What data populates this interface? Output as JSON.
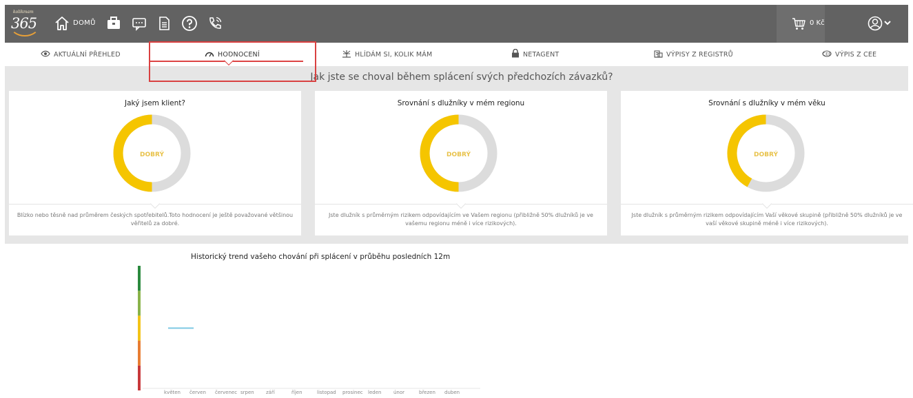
{
  "topbar": {
    "logo_brand": "kolikmam",
    "logo_number": "365",
    "home_label": "DOMŮ",
    "icons": [
      "home-icon",
      "briefcase-icon",
      "chat-icon",
      "document-icon",
      "help-icon",
      "phone-icon"
    ],
    "cart_label": "0 Kč",
    "user_icon": "user-icon",
    "colors": {
      "bar": "#626262",
      "cart_bg": "#6e6e6e"
    }
  },
  "tabs": [
    {
      "label": "AKTUÁLNÍ PŘEHLED",
      "icon": "eye-icon"
    },
    {
      "label": "HODNOCENÍ",
      "icon": "gauge-icon",
      "active": true
    },
    {
      "label": "HLÍDÁM SI, KOLIK MÁM",
      "icon": "radar-icon"
    },
    {
      "label": "NETAGENT",
      "icon": "lock-icon"
    },
    {
      "label": "VÝPISY Z REGISTRŮ",
      "icon": "building-icon"
    },
    {
      "label": "VÝPIS Z CEE",
      "icon": "cee-icon"
    }
  ],
  "main": {
    "subtitle": "Jak jste se choval během splácení svých předchozích závazků?"
  },
  "cards": [
    {
      "title": "Jaký jsem klient?",
      "rating": "DOBRÝ",
      "fill": 0.5,
      "desc": "Blízko nebo těsně nad průměrem českých spotřebitelů.Toto hodnocení je ještě považované většinou věřitelů za dobré."
    },
    {
      "title": "Srovnání s dlužníky v mém regionu",
      "rating": "DOBRÝ",
      "fill": 0.5,
      "desc": "Jste dlužník s průměrným rizikem odpovídajícím ve Vašem regionu (přibližně 50% dlužníků je ve vašemu regionu méně i více rizikových)."
    },
    {
      "title": "Srovnání s dlužníky v mém věku",
      "rating": "DOBRÝ",
      "fill": 0.42,
      "desc": "Jste dlužník s průměrným rizikem odpovídajícím Vaší věkové skupině (přibližně 50% dlužníků je ve vaší věkové skupině méně i více rizikových)."
    }
  ],
  "colors": {
    "accent_yellow": "#f5c500",
    "track_gray": "#dcdcdc",
    "rating_text": "#e8c24a",
    "active_tab": "#d44444"
  },
  "chart_data": {
    "type": "line",
    "title": "Historický trend vašeho chování při splácení v průběhu posledních 12m",
    "categories": [
      "květen",
      "červen",
      "červenec",
      "srpen",
      "září",
      "říjen",
      "listopad",
      "prosinec",
      "leden",
      "únor",
      "březen",
      "duben"
    ],
    "band_colors": [
      "#c8393b",
      "#e87d33",
      "#f3c418",
      "#8ab34a",
      "#2b8a3e"
    ],
    "series": [
      {
        "values": [
          2.5,
          2.5,
          null,
          null,
          null,
          null,
          null,
          null,
          null,
          null,
          null,
          null
        ],
        "color": "#7ec8e3"
      }
    ],
    "ylim": [
      0,
      5
    ],
    "grid": false
  }
}
